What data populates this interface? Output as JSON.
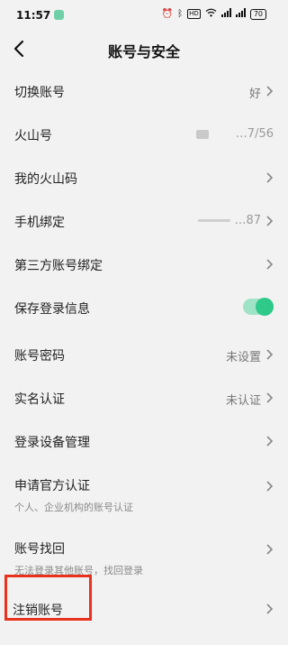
{
  "status_bar": {
    "time": "11:57",
    "icons": [
      "alarm-icon",
      "bluetooth-icon",
      "hd-icon",
      "wifi-icon",
      "signal-icon",
      "signal-icon"
    ],
    "hd_label": "HD",
    "battery": "70"
  },
  "header": {
    "title": "账号与安全",
    "back_icon": "chevron-left-icon"
  },
  "items": [
    {
      "label": "切换账号",
      "value": "好"
    },
    {
      "label": "火山号",
      "value": "…7/56"
    },
    {
      "label": "我的火山码"
    },
    {
      "label": "手机绑定",
      "value": "…87"
    },
    {
      "label": "第三方账号绑定"
    },
    {
      "label": "保存登录信息",
      "toggle": true
    },
    {
      "label": "账号密码",
      "value": "未设置"
    },
    {
      "label": "实名认证",
      "value": "未认证"
    },
    {
      "label": "登录设备管理"
    },
    {
      "label": "申请官方认证",
      "sub": "个人、企业机构的账号认证"
    },
    {
      "label": "账号找回",
      "sub": "无法登录其他账号，找回登录"
    },
    {
      "label": "注销账号"
    }
  ],
  "colors": {
    "background": "#f2f2f2",
    "toggle_on": "#2fc98a",
    "highlight": "#e8321e"
  }
}
